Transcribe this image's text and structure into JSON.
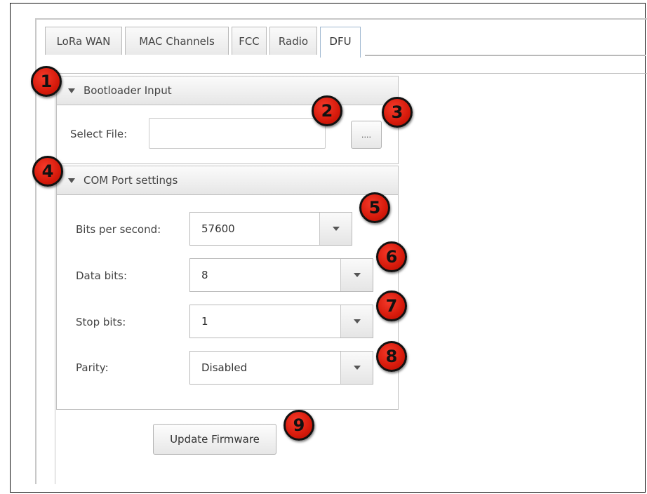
{
  "tabs": [
    {
      "label": "LoRa WAN"
    },
    {
      "label": "MAC Channels"
    },
    {
      "label": "FCC"
    },
    {
      "label": "Radio"
    },
    {
      "label": "DFU"
    }
  ],
  "bootloader": {
    "header": "Bootloader Input",
    "select_file_label": "Select File:",
    "file_value": "",
    "browse_label": "...."
  },
  "com_port": {
    "header": "COM Port settings",
    "bits_per_second": {
      "label": "Bits per second:",
      "value": "57600"
    },
    "data_bits": {
      "label": "Data bits:",
      "value": "8"
    },
    "stop_bits": {
      "label": "Stop bits:",
      "value": "1"
    },
    "parity": {
      "label": "Parity:",
      "value": "Disabled"
    }
  },
  "update_button": "Update Firmware",
  "callouts": [
    "1",
    "2",
    "3",
    "4",
    "5",
    "6",
    "7",
    "8",
    "9"
  ],
  "colors": {
    "callout": "#e02010",
    "border": "#c0c0c0"
  }
}
